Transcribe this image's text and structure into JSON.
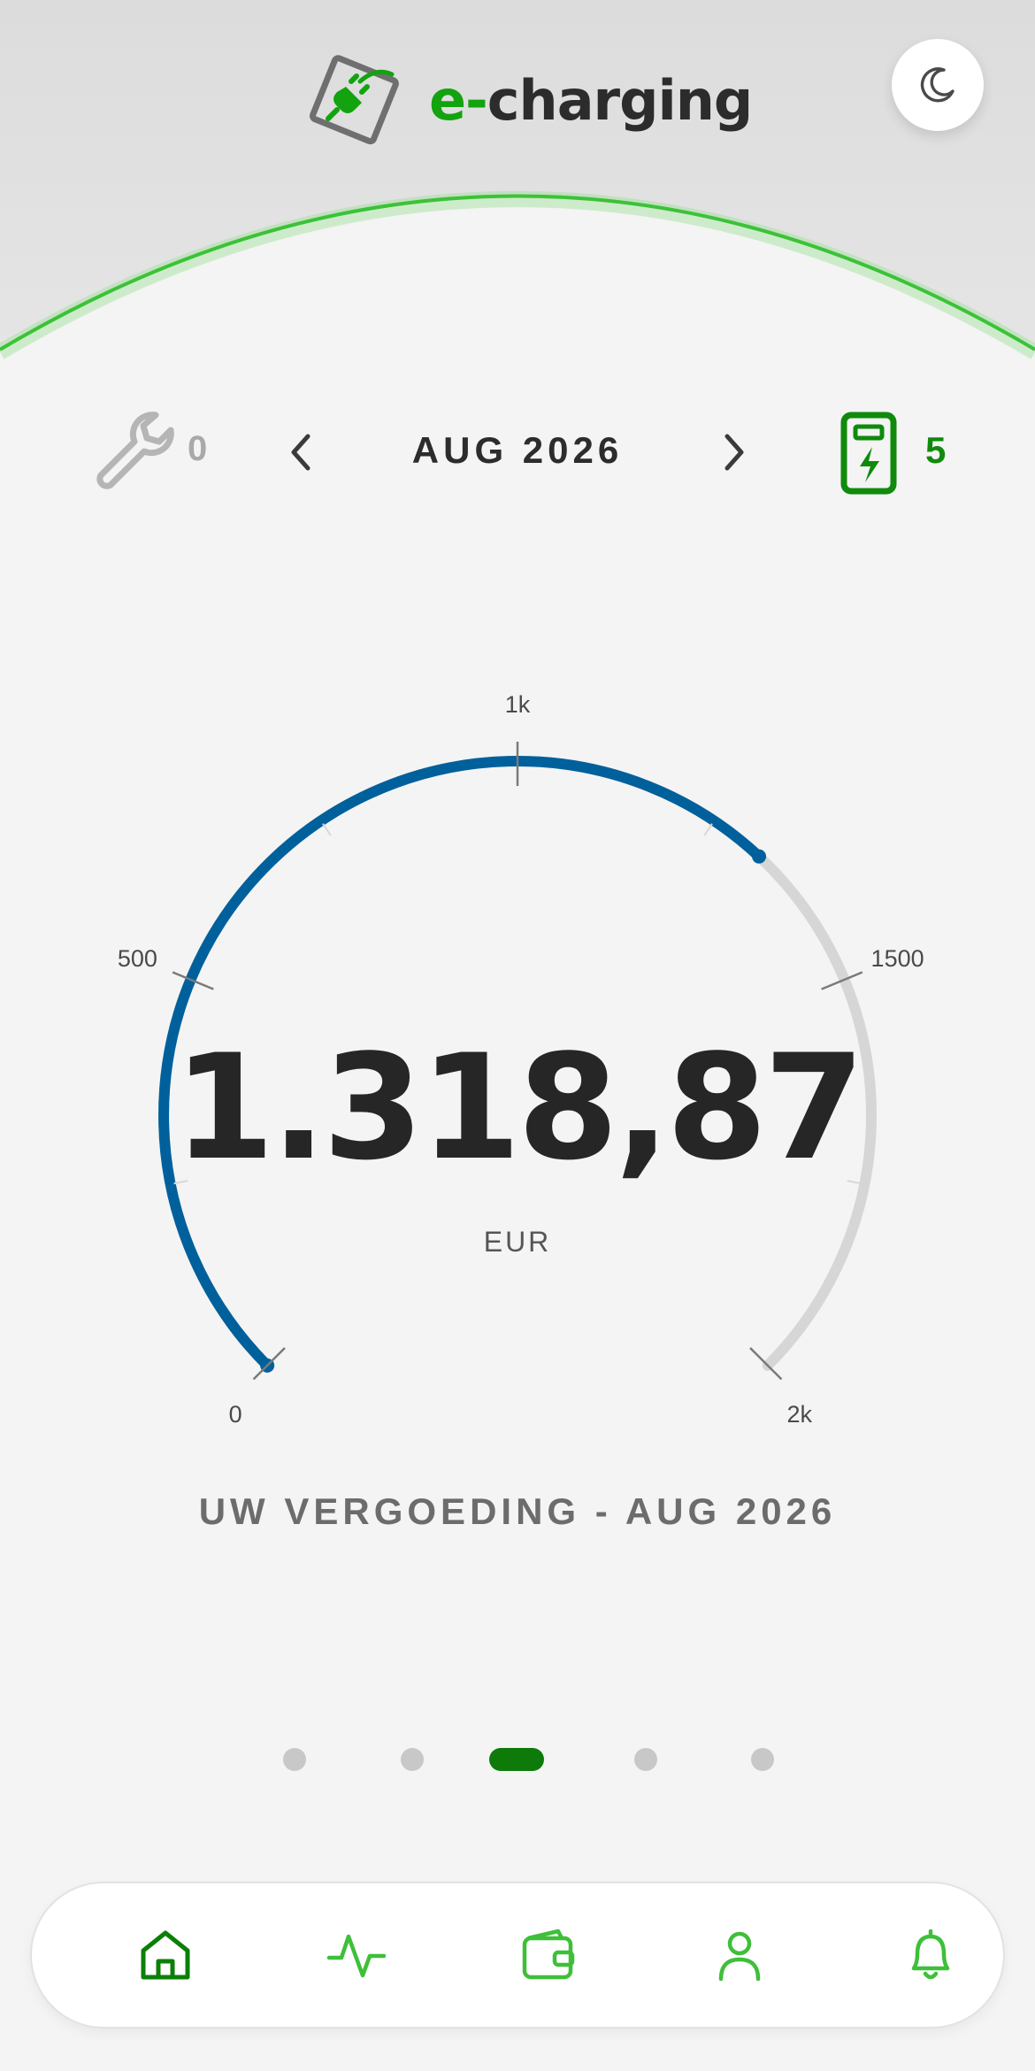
{
  "app": {
    "brand_prefix": "e-",
    "brand_suffix": "charging",
    "accent_color": "#12a30f"
  },
  "header": {
    "theme_toggle_icon": "moon-icon"
  },
  "status": {
    "maintenance_count": "0",
    "maintenance_icon": "wrench-icon",
    "month": "AUG 2026",
    "prev_icon": "chevron-left-icon",
    "next_icon": "chevron-right-icon",
    "chargers_count": "5",
    "chargers_icon": "charging-station-icon"
  },
  "gauge": {
    "min": 0,
    "max": 2000,
    "value": 1318.87,
    "value_display": "1.318,87",
    "currency": "EUR",
    "tick_labels": [
      "0",
      "500",
      "1k",
      "1500",
      "2k"
    ],
    "fill_color": "#00609c",
    "track_color": "#d6d6d6"
  },
  "caption": "UW VERGOEDING - AUG 2026",
  "pager": {
    "count": 5,
    "active_index": 2
  },
  "nav": {
    "items": [
      {
        "icon": "home-icon",
        "active": true
      },
      {
        "icon": "activity-icon",
        "active": false
      },
      {
        "icon": "wallet-icon",
        "active": false
      },
      {
        "icon": "user-icon",
        "active": false
      },
      {
        "icon": "bell-icon",
        "active": false
      }
    ]
  }
}
